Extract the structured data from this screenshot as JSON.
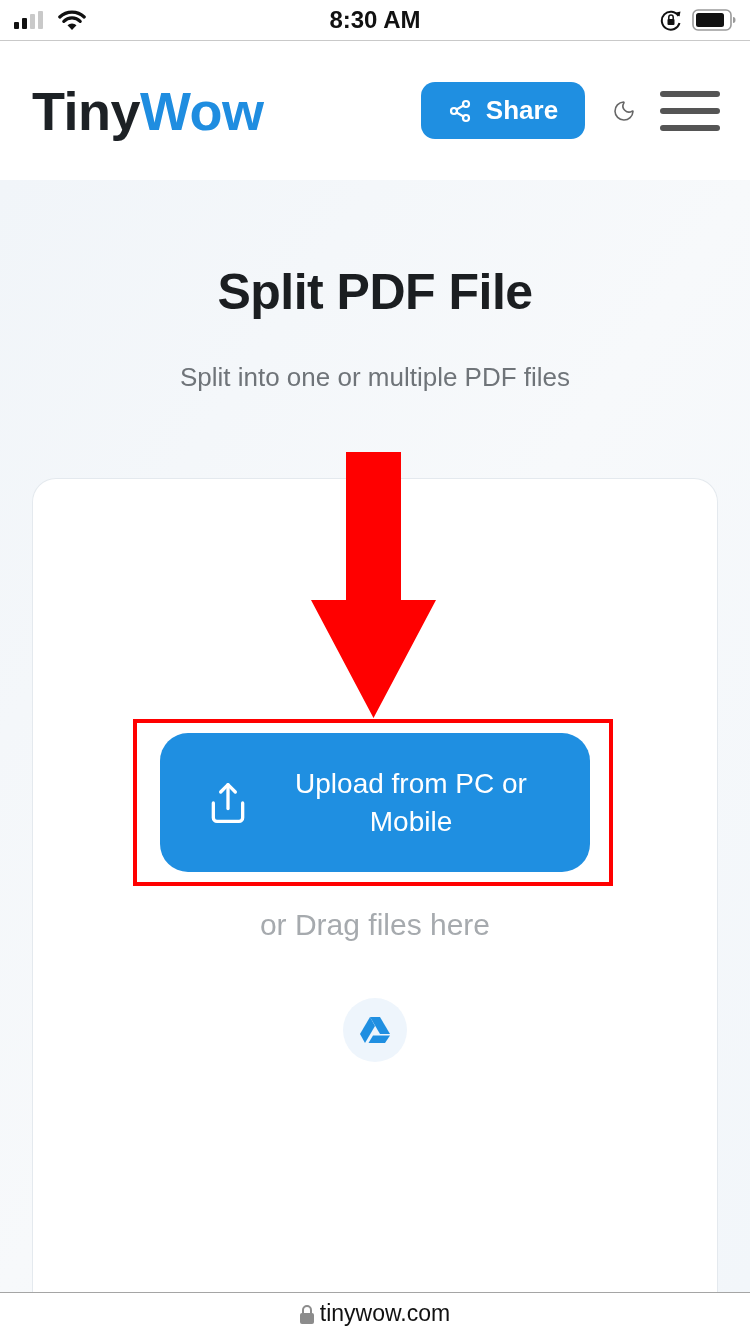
{
  "status_bar": {
    "time": "8:30 AM"
  },
  "header": {
    "logo": {
      "first_part": "Tiny",
      "second_part": "Wow"
    },
    "share_button": {
      "label": "Share"
    }
  },
  "tool": {
    "title": "Split PDF File",
    "subtitle": "Split into one or multiple PDF files"
  },
  "upload": {
    "button": {
      "label": "Upload from PC or Mobile"
    },
    "drag_hint": "or Drag files here"
  },
  "browser_bar": {
    "url": "tinywow.com"
  }
}
